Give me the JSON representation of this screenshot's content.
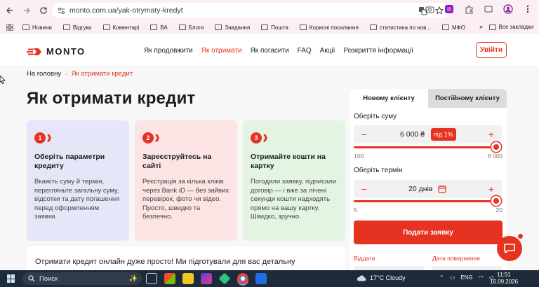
{
  "browser": {
    "url": "monto.com.ua/yak-otrymaty-kredyt",
    "bookmarks": [
      "Новини",
      "Відгуки",
      "Коментарі",
      "ВА",
      "Блоги",
      "Завдання",
      "Пошта",
      "Корисні посилання",
      "статистика по нов...",
      "МФО"
    ],
    "bookmarks_more": "»",
    "all_bookmarks": "Все закладки"
  },
  "site": {
    "logo": "MONTO",
    "menu": [
      {
        "label": "Як продовжити",
        "active": false
      },
      {
        "label": "Як отримати",
        "active": true
      },
      {
        "label": "Як погасити",
        "active": false
      },
      {
        "label": "FAQ",
        "active": false
      },
      {
        "label": "Акції",
        "active": false
      },
      {
        "label": "Розкриття інформації",
        "active": false
      }
    ],
    "login": "Увійти"
  },
  "breadcrumb": {
    "home": "На головну",
    "sep": "›",
    "current": "Як отримати кредит"
  },
  "title": "Як отримати кредит",
  "steps": [
    {
      "num": "1",
      "title": "Оберіть параметри кредиту",
      "text": "Вкажіть суму й термін, перегляньте загальну суму, відсотки та дату погашення перед оформленням заявки."
    },
    {
      "num": "2",
      "title": "Зареєструйтесь на сайті",
      "text": "Реєстрація за кілька кліків через Bank iD — без зайвих перевірок, фото чи відео. Просто, швидко та безпечно."
    },
    {
      "num": "3",
      "title": "Отримайте кошти на картку",
      "text": "Погодили заявку, підписали договір — і вже за лічені секунди кошти надходять прямо на вашу картку. Швидко, зручно."
    }
  ],
  "intro": "Отримати кредит онлайн дуже просто! Ми підготували для вас детальну",
  "calculator": {
    "tabs": [
      {
        "label": "Новому клієнту",
        "active": true
      },
      {
        "label": "Постійному клієнту",
        "active": false
      }
    ],
    "amount_label": "Оберіть суму",
    "amount_value": "6 000 ₴",
    "rate_badge": "під 1%",
    "amount_min": "100",
    "amount_max": "6 000",
    "amount_level": 1.0,
    "term_label": "Оберіть термін",
    "term_value": "20 днів",
    "term_min": "5",
    "term_max": "20",
    "term_level": 1.0,
    "minus": "−",
    "plus": "+",
    "submit": "Подати заявку",
    "give_back_label": "Віддати",
    "return_date_label": "Дата повернення"
  },
  "taskbar": {
    "search": "Поиск",
    "weather": "17°C  Cloudy",
    "lang": "ENG",
    "time": "11:51",
    "date": "16.09.2026"
  },
  "colors": {
    "accent": "#e63221",
    "step1": "#e5e6f8",
    "step2": "#fbe4e3",
    "step3": "#e4f4e3"
  }
}
